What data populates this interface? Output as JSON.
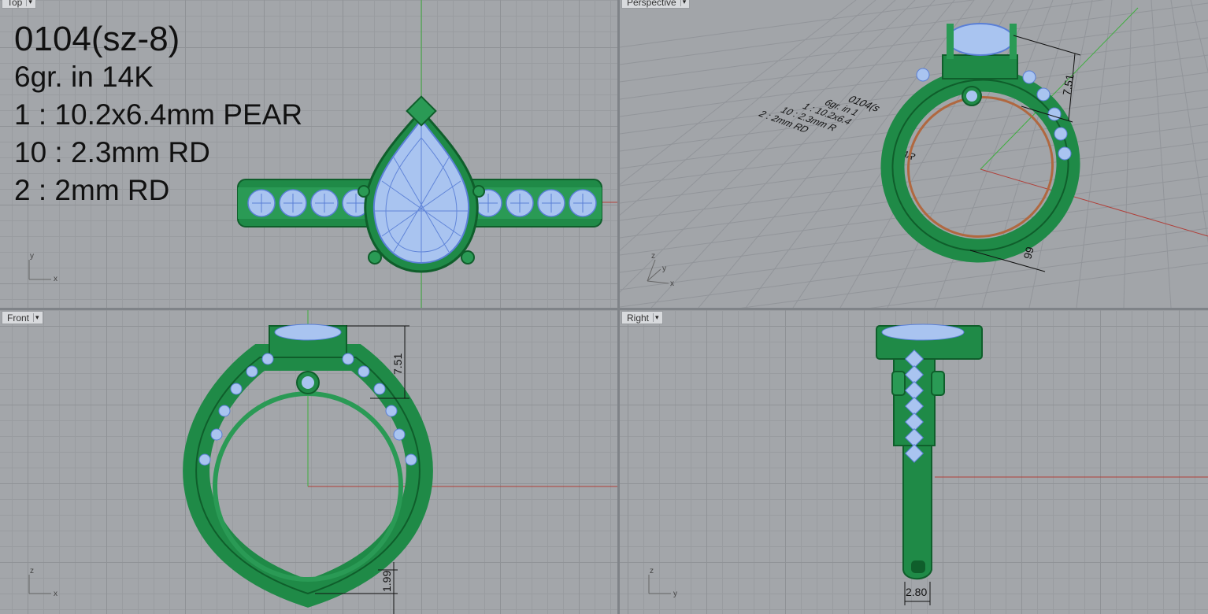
{
  "viewports": {
    "top": {
      "label": "Top"
    },
    "perspective": {
      "label": "Perspective"
    },
    "front": {
      "label": "Front"
    },
    "right": {
      "label": "Right"
    }
  },
  "annotation": {
    "line0": "0104(sz-8)",
    "line1": "6gr.  in 14K",
    "line2": "1 : 10.2x6.4mm PEAR",
    "line3": "10 : 2.3mm RD",
    "line4": "2 : 2mm RD"
  },
  "perspective_annotation": {
    "line0": "0104(s",
    "line1": "6gr.  in 1",
    "line2": "1 : 10.2x6.4",
    "line3": "10 : 2.3mm R",
    "line4": "2 : 2mm RD",
    "pear": "PEAR"
  },
  "dimensions": {
    "height": "7.51",
    "bottom": "1.99",
    "persp_bottom": "99",
    "width": "2.80"
  },
  "axes": {
    "x": "x",
    "y": "y",
    "z": "z"
  },
  "colors": {
    "metal": "#1f8a47",
    "metal_dark": "#0f5e2b",
    "gem": "#a9c4f0",
    "gem_line": "#5a7fd6",
    "x_axis": "#b0403a",
    "y_axis": "#3fae3f"
  }
}
